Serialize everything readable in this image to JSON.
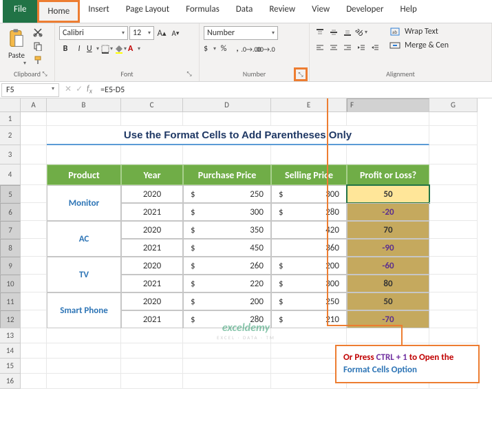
{
  "tabs": [
    "File",
    "Home",
    "Insert",
    "Page Layout",
    "Formulas",
    "Data",
    "Review",
    "View",
    "Developer",
    "Help"
  ],
  "ribbon": {
    "clipboard": {
      "paste": "Paste",
      "label": "Clipboard"
    },
    "font": {
      "name": "Calibri",
      "size": "12",
      "label": "Font"
    },
    "number": {
      "format": "Number",
      "label": "Number"
    },
    "alignment": {
      "wrap": "Wrap Text",
      "merge": "Merge & Cen",
      "label": "Alignment"
    }
  },
  "namebox": "F5",
  "formula": "=E5-D5",
  "cols": [
    "A",
    "B",
    "C",
    "D",
    "E",
    "F",
    "G"
  ],
  "title": "Use the Format Cells to Add Parentheses Only",
  "headers": [
    "Product",
    "Year",
    "Purchase Price",
    "Selling Price",
    "Profit or Loss?"
  ],
  "rows": [
    {
      "product": "Monitor",
      "year": "2020",
      "pp": "250",
      "sp": "300",
      "pl": "50",
      "neg": false
    },
    {
      "product": "",
      "year": "2021",
      "pp": "300",
      "sp": "280",
      "pl": "-20",
      "neg": true
    },
    {
      "product": "AC",
      "year": "2020",
      "pp": "350",
      "sp": "420",
      "pl": "70",
      "neg": false
    },
    {
      "product": "",
      "year": "2021",
      "pp": "450",
      "sp": "360",
      "pl": "-90",
      "neg": true
    },
    {
      "product": "TV",
      "year": "2020",
      "pp": "260",
      "sp": "200",
      "pl": "-60",
      "neg": true
    },
    {
      "product": "",
      "year": "2021",
      "pp": "220",
      "sp": "300",
      "pl": "80",
      "neg": false
    },
    {
      "product": "Smart Phone",
      "year": "2020",
      "pp": "200",
      "sp": "250",
      "pl": "50",
      "neg": false
    },
    {
      "product": "",
      "year": "2021",
      "pp": "280",
      "sp": "210",
      "pl": "-70",
      "neg": true
    }
  ],
  "callout": {
    "t1": "Or Press ",
    "t2": "CTRL + 1",
    "t3": " to Open the ",
    "t4": "Format Cells Option"
  },
  "wm": {
    "logo": "exceldemy",
    "sub": "EXCEL · DATA · TM"
  }
}
